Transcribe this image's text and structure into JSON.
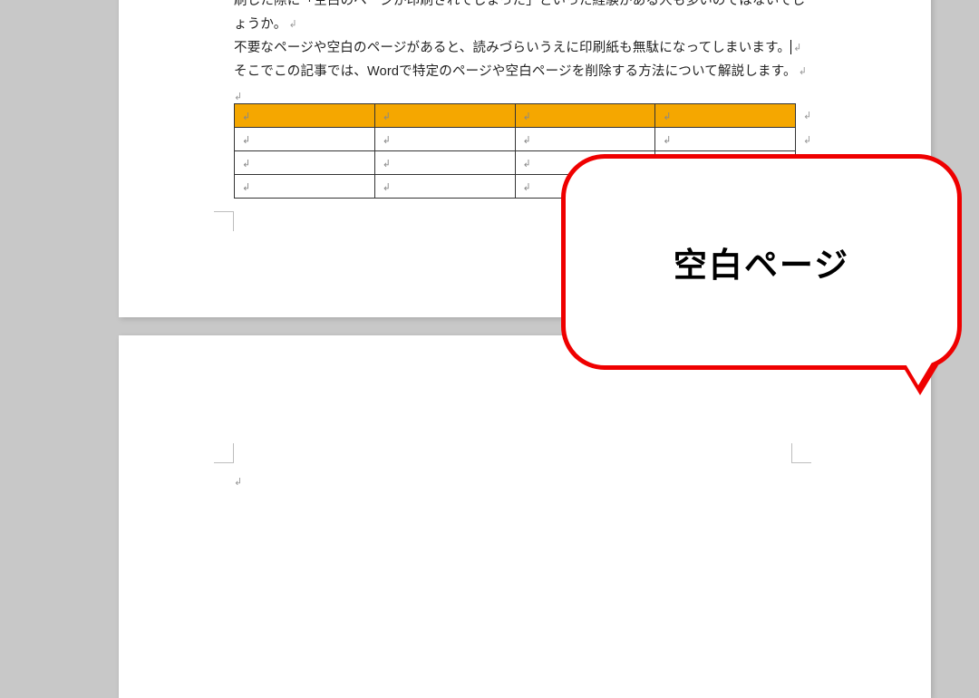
{
  "document": {
    "paragraphs": [
      "刷した際に「空白のページが印刷されてしまった」といった経験がある人も多いのではないでしょうか。",
      "不要なページや空白のページがあると、読みづらいうえに印刷紙も無駄になってしまいます。",
      "そこでこの記事では、Wordで特定のページや空白ページを削除する方法について解説します。"
    ],
    "return_mark": "↲",
    "table": {
      "rows": 4,
      "cols": 4,
      "header_bg": "#f5a700"
    }
  },
  "callout": {
    "text": "空白ページ",
    "border_color": "#ef0000"
  }
}
